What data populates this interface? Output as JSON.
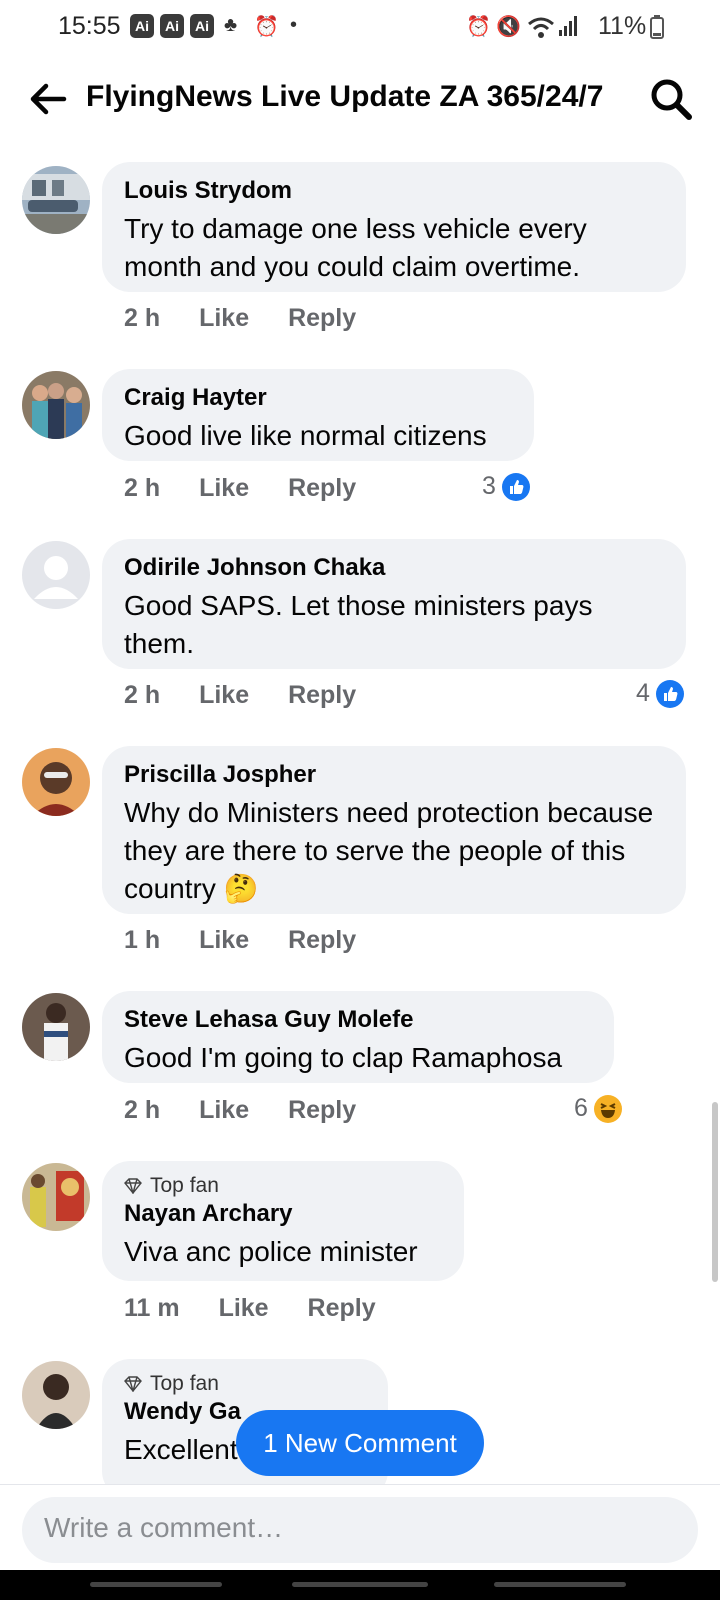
{
  "status_bar": {
    "time": "15:55",
    "ai_badges": [
      "Ai",
      "Ai",
      "Ai"
    ],
    "battery": "11%"
  },
  "header": {
    "title": "FlyingNews Live Update ZA 365/24/7"
  },
  "actions": {
    "like": "Like",
    "reply": "Reply"
  },
  "comments": [
    {
      "author": "Louis Strydom",
      "text": "Try to damage one less vehicle every month and you could claim overtime.",
      "time": "2 h"
    },
    {
      "author": "Craig Hayter",
      "text": "Good live like normal citizens",
      "time": "2 h",
      "reaction_count": "3"
    },
    {
      "author": "Odirile Johnson Chaka",
      "text": "Good SAPS. Let those ministers pays them.",
      "time": "2 h",
      "reaction_count": "4"
    },
    {
      "author": "Priscilla Jospher",
      "text": "Why do Ministers need protection because they are there to serve the people of this country 🤔",
      "time": "1 h"
    },
    {
      "author": "Steve Lehasa Guy Molefe",
      "text": "Good I'm going to clap Ramaphosa",
      "time": "2 h",
      "reaction_count": "6"
    },
    {
      "badge": "Top fan",
      "author": "Nayan Archary",
      "text": "Viva anc police minister",
      "time": "11 m"
    },
    {
      "badge": "Top fan",
      "author": "Wendy Ga",
      "text": "Excellent"
    }
  ],
  "new_comment_label": "1 New Comment",
  "composer": {
    "placeholder": "Write a comment…"
  }
}
